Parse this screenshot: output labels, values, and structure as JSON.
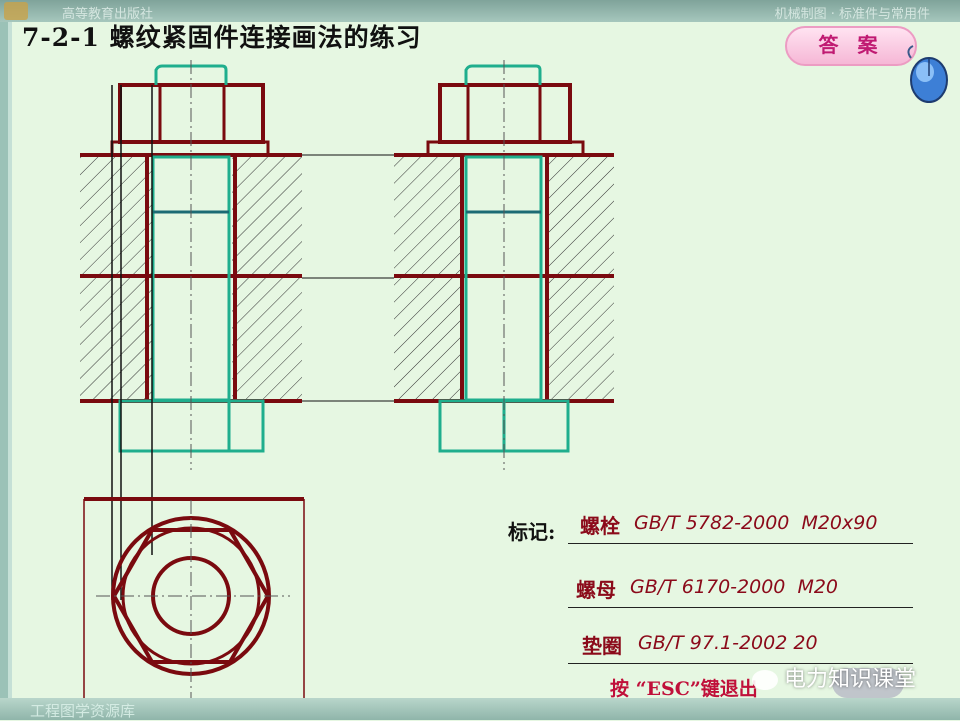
{
  "header": {
    "publisher": "高等教育出版社",
    "course": "机械制图 · 标准件与常用件"
  },
  "title": "7-2-1 螺纹紧固件连接画法的练习",
  "answer_button": "答 案",
  "markings": {
    "label": "标记:",
    "rows": [
      {
        "name": "螺栓",
        "standard": "GB/T 5782-2000  M20x90"
      },
      {
        "name": "螺母",
        "standard": "GB/T 6170-2000  M20"
      },
      {
        "name": "垫圈",
        "standard": "GB/T 97.1-2002 20"
      }
    ]
  },
  "esc_hint": "按 “ESC”键退出",
  "footer": {
    "library": "工程图学资源库"
  },
  "watermark": "电力知识课堂",
  "colors": {
    "outline": "#7a0a0f",
    "hidden_bolt": "#1fae8d",
    "hatch": "#333333",
    "background": "#e6f7e2"
  },
  "icons": [
    "mouse-icon",
    "exit-button",
    "wechat-icon"
  ]
}
